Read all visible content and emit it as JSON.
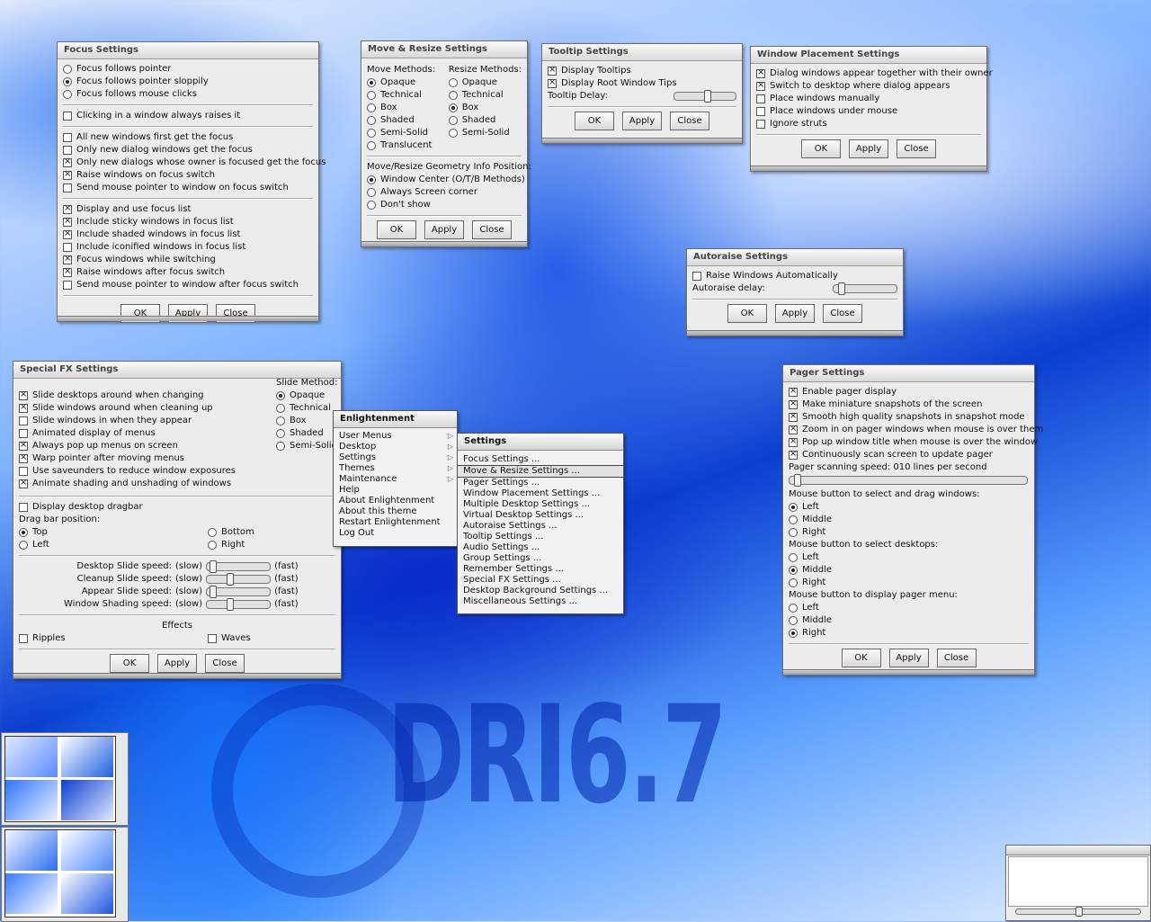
{
  "desktop": {
    "logo_text": "DRI6.7"
  },
  "focus": {
    "title": "Focus Settings",
    "opts": [
      "Focus follows pointer",
      "Focus follows pointer sloppily",
      "Focus follows mouse clicks"
    ],
    "opt_on": 1,
    "click_raise": "Clicking in a window always raises it",
    "grp2": [
      {
        "label": "All new windows first get the focus",
        "on": false
      },
      {
        "label": "Only new dialog windows get the focus",
        "on": false
      },
      {
        "label": "Only new dialogs whose owner is focused get the focus",
        "on": true
      },
      {
        "label": "Raise windows on focus switch",
        "on": true
      },
      {
        "label": "Send mouse pointer to window on focus switch",
        "on": false
      }
    ],
    "grp3": [
      {
        "label": "Display and use focus list",
        "on": true
      },
      {
        "label": "Include sticky windows in focus list",
        "on": true
      },
      {
        "label": "Include shaded windows in focus list",
        "on": true
      },
      {
        "label": "Include iconified windows in focus list",
        "on": false
      },
      {
        "label": "Focus windows while switching",
        "on": true
      },
      {
        "label": "Raise windows after focus switch",
        "on": true
      },
      {
        "label": "Send mouse pointer to window after focus switch",
        "on": false
      }
    ]
  },
  "buttons": {
    "ok": "OK",
    "apply": "Apply",
    "close": "Close"
  },
  "move": {
    "title": "Move & Resize Settings",
    "move_hdr": "Move Methods:",
    "resize_hdr": "Resize Methods:",
    "move_opts": [
      "Opaque",
      "Technical",
      "Box",
      "Shaded",
      "Semi-Solid",
      "Translucent"
    ],
    "resize_opts": [
      "Opaque",
      "Technical",
      "Box",
      "Shaded",
      "Semi-Solid"
    ],
    "info_hdr": "Move/Resize Geometry Info Position:",
    "info_opts": [
      "Window Center (O/T/B Methods)",
      "Always Screen corner",
      "Don't show"
    ]
  },
  "tooltip": {
    "title": "Tooltip Settings",
    "display": "Display Tooltips",
    "root": "Display Root Window Tips",
    "delay": "Tooltip Delay:",
    "delay_level": 0.55
  },
  "placement": {
    "title": "Window Placement Settings",
    "items": [
      {
        "label": "Dialog windows appear together with their owner",
        "on": true
      },
      {
        "label": "Switch to desktop where dialog appears",
        "on": true
      },
      {
        "label": "Place windows manually",
        "on": false
      },
      {
        "label": "Place windows under mouse",
        "on": false
      },
      {
        "label": "Ignore struts",
        "on": false
      }
    ]
  },
  "autoraise": {
    "title": "Autoraise Settings",
    "raise": "Raise Windows Automatically",
    "delay": "Autoraise delay:",
    "delay_level": 0.08
  },
  "fx": {
    "title": "Special FX Settings",
    "checks": [
      {
        "label": "Slide desktops around when changing",
        "on": true
      },
      {
        "label": "Slide windows around when cleaning up",
        "on": true
      },
      {
        "label": "Slide windows in when they appear",
        "on": false
      },
      {
        "label": "Animated display of menus",
        "on": false
      },
      {
        "label": "Always pop up menus on screen",
        "on": true
      },
      {
        "label": "Warp pointer after moving menus",
        "on": true
      },
      {
        "label": "Use saveunders to reduce window exposures",
        "on": false
      },
      {
        "label": "Animate shading and unshading of windows",
        "on": true
      }
    ],
    "slide_hdr": "Slide Method:",
    "slide_opts": [
      "Opaque",
      "Technical",
      "Box",
      "Shaded",
      "Semi-Solid"
    ],
    "dragbar": "Display desktop dragbar",
    "dragbar_pos": "Drag bar position:",
    "pos_top": "Top",
    "pos_bottom": "Bottom",
    "pos_left": "Left",
    "pos_right": "Right",
    "sliders": [
      {
        "label": "Desktop Slide speed:",
        "level": 0.05
      },
      {
        "label": "Cleanup Slide speed:",
        "level": 0.35
      },
      {
        "label": "Appear Slide speed:",
        "level": 0.05
      },
      {
        "label": "Window Shading speed:",
        "level": 0.35
      }
    ],
    "slow": "(slow)",
    "fast": "(fast)",
    "effects": "Effects",
    "ripples": "Ripples",
    "waves": "Waves"
  },
  "emenu": {
    "title": "Enlightenment",
    "items": [
      {
        "label": "User Menus",
        "sub": true
      },
      {
        "label": "Desktop",
        "sub": true
      },
      {
        "label": "Settings",
        "sub": true
      },
      {
        "label": "Themes",
        "sub": true
      },
      {
        "label": "Maintenance",
        "sub": true
      },
      {
        "label": "Help",
        "sub": false
      },
      {
        "label": "About Enlightenment",
        "sub": false
      },
      {
        "label": "About this theme",
        "sub": false
      },
      {
        "label": "Restart Enlightenment",
        "sub": false
      },
      {
        "label": "Log Out",
        "sub": false
      }
    ]
  },
  "smenu": {
    "title": "Settings",
    "items": [
      "Focus Settings ...",
      "Move & Resize Settings ...",
      "Pager Settings ...",
      "Window Placement Settings ...",
      "Multiple Desktop Settings ...",
      "Virtual Desktop Settings ...",
      "Autoraise Settings ...",
      "Tooltip Settings ...",
      "Audio Settings ...",
      "Group Settings ...",
      "Remember Settings ...",
      "Special FX Settings ...",
      "Desktop Background Settings ...",
      "Miscellaneous Settings ..."
    ]
  },
  "pagerset": {
    "title": "Pager Settings",
    "checks": [
      {
        "label": "Enable pager display",
        "on": true
      },
      {
        "label": "Make miniature snapshots of the screen",
        "on": true
      },
      {
        "label": "Smooth high quality snapshots in snapshot mode",
        "on": true
      },
      {
        "label": "Zoom in on pager windows when mouse is over them",
        "on": true
      },
      {
        "label": "Pop up window title when mouse is over the window",
        "on": true
      },
      {
        "label": "Continuously scan screen to update pager",
        "on": true
      }
    ],
    "scan": "Pager scanning speed: 010 lines per second",
    "scan_level": 0.02,
    "sel_drag": "Mouse button to select and drag windows:",
    "sel_desk": "Mouse button to select desktops:",
    "menu_btn": "Mouse button to display pager menu:",
    "left": "Left",
    "middle": "Middle",
    "right": "Right"
  }
}
